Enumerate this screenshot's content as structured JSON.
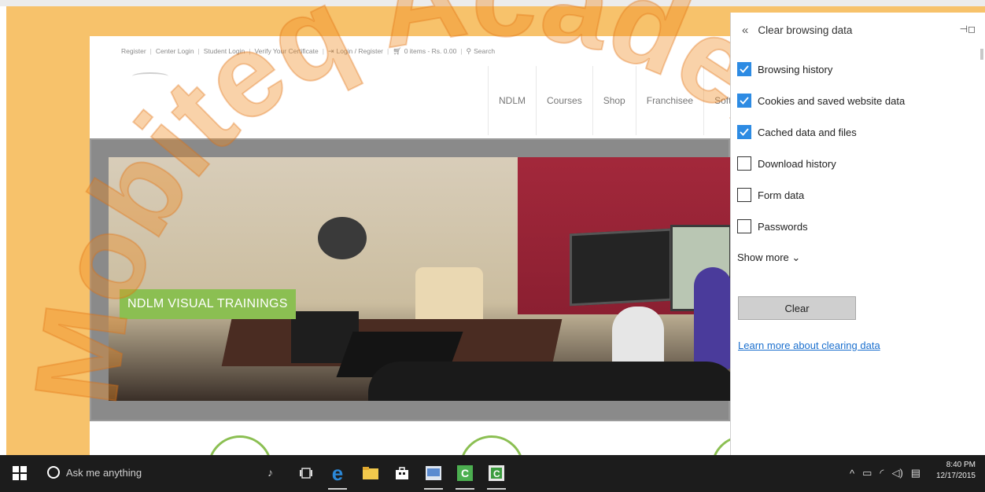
{
  "website": {
    "topbar": {
      "register": "Register",
      "center_login": "Center Login",
      "student_login": "Student Login",
      "verify_certificate": "Verify Your Certificate",
      "login_register": "Login / Register",
      "cart": "0 items - Rs. 0.00",
      "search": "Search"
    },
    "nav": [
      "NDLM",
      "Courses",
      "Shop",
      "Franchisee",
      "Softw"
    ],
    "hero_label": "NDLM VISUAL TRAININGS"
  },
  "panel": {
    "title": "Clear browsing data",
    "options": [
      {
        "label": "Browsing history",
        "checked": true
      },
      {
        "label": "Cookies and saved website data",
        "checked": true
      },
      {
        "label": "Cached data and files",
        "checked": true
      },
      {
        "label": "Download history",
        "checked": false
      },
      {
        "label": "Form data",
        "checked": false
      },
      {
        "label": "Passwords",
        "checked": false
      }
    ],
    "show_more": "Show more ⌄",
    "clear_button": "Clear",
    "learn_more_link": "Learn more about clearing data"
  },
  "watermark": "Mobiteq Academy",
  "taskbar": {
    "search_placeholder": "Ask me anything",
    "time": "8:40 PM",
    "date": "12/17/2015"
  },
  "colors": {
    "checkbox_on": "#2d8be3",
    "hero_label_bg": "#8bbf52",
    "link": "#1a6fce",
    "taskbar": "#1c1c1c"
  }
}
